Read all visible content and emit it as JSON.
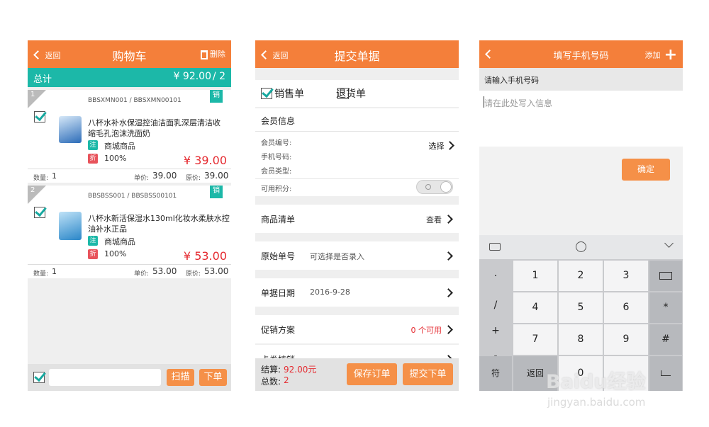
{
  "panel1": {
    "back_label": "返回",
    "title": "购物车",
    "delete_label": "删除",
    "total_label": "总计",
    "total_value": "¥ 92.00",
    "total_count": "/ 2",
    "items": [
      {
        "index": "1",
        "code": "BBSXMN001 / BBSXMN00101",
        "badge": "销",
        "name": "八杯水补水保湿控油洁面乳深层清洁收缩毛孔泡沫洗面奶",
        "tag1": "注",
        "tag1_text": "商城商品",
        "tag2": "折",
        "discount": "100%",
        "price": "¥ 39.00",
        "qty_label": "数量:",
        "qty": "1",
        "unit_label": "单价:",
        "unit_price": "39.00",
        "orig_label": "原价:",
        "orig_price": "39.00"
      },
      {
        "index": "2",
        "code": "BBSBSS001 / BBSBSS00101",
        "badge": "销",
        "name": "八杯水新活保湿水130ml化妆水柔肤水控油补水正品",
        "tag1": "注",
        "tag1_text": "商城商品",
        "tag2": "折",
        "discount": "100%",
        "price": "¥ 53.00",
        "qty_label": "数量:",
        "qty": "1",
        "unit_label": "单价:",
        "unit_price": "53.00",
        "orig_label": "原价:",
        "orig_price": "53.00"
      }
    ],
    "scan_label": "扫描",
    "order_label": "下单"
  },
  "panel2": {
    "back_label": "返回",
    "title": "提交单据",
    "sale_label": "销售单",
    "return_label": "退货单",
    "member_section": "会员信息",
    "member_no": "会员编号:",
    "phone": "手机号码:",
    "member_type": "会员类型:",
    "select_label": "选择",
    "points_label": "可用积分:",
    "goods_label": "商品清单",
    "view_label": "查看",
    "orig_no_label": "原始单号",
    "orig_no_hint": "可选择是否录入",
    "date_label": "单据日期",
    "date_value": "2016-9-28",
    "promo_label": "促销方案",
    "promo_value": "0 个可用",
    "coupon_label": "卡券核销",
    "settle_label": "结算:",
    "settle_value": "92.00元",
    "count_label": "总数:",
    "count_value": "2",
    "save_label": "保存订单",
    "submit_label": "提交下单"
  },
  "panel3": {
    "title": "填写手机号码",
    "add_label": "添加",
    "prompt": "请输入手机号码",
    "placeholder": "请在此处写入信息",
    "confirm_label": "确定",
    "keys": {
      "dot": "·",
      "slash": "/",
      "plus": "+",
      "minus": "-",
      "k1": "1",
      "k2": "2",
      "k3": "3",
      "k4": "4",
      "k5": "5",
      "k6": "6",
      "k7": "7",
      "k8": "8",
      "k9": "9",
      "k0": "0",
      "star": "*",
      "hash": "#",
      "sym": "符",
      "back": "返回"
    }
  },
  "watermark": {
    "logo": "Baidu经验",
    "url": "jingyan.baidu.com"
  },
  "colors": {
    "orange": "#f47f3a",
    "teal": "#1cb8a8",
    "red": "#e52a30"
  }
}
